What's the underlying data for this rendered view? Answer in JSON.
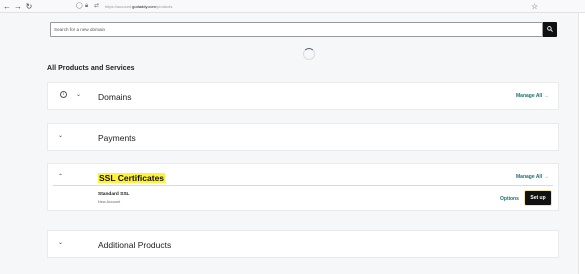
{
  "browser": {
    "url_prefix": "https://account.",
    "url_domain": "godaddy.com",
    "url_path": "/products"
  },
  "search": {
    "placeholder": "Search for a new domain"
  },
  "section": {
    "title": "All Products and Services"
  },
  "cards": {
    "domains": {
      "title": "Domains",
      "manage": "Manage All →"
    },
    "payments": {
      "title": "Payments"
    },
    "ssl": {
      "title": "SSL Certificates",
      "manage": "Manage All →",
      "product": {
        "name": "Standard SSL",
        "status": "New Account",
        "options": "Options",
        "setup": "Set up"
      }
    },
    "additional": {
      "title": "Additional Products"
    }
  }
}
